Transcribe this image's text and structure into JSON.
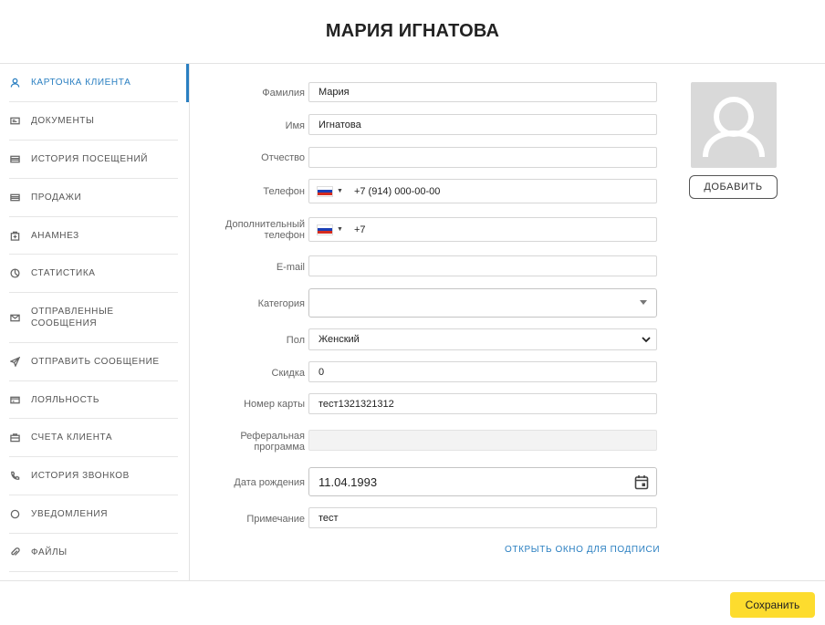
{
  "header": {
    "title": "МАРИЯ ИГНАТОВА"
  },
  "sidebar": {
    "items": [
      {
        "label": "КАРТОЧКА КЛИЕНТА",
        "icon": "user-icon",
        "active": true
      },
      {
        "label": "ДОКУМЕНТЫ",
        "icon": "id-card-icon"
      },
      {
        "label": "ИСТОРИЯ ПОСЕЩЕНИЙ",
        "icon": "list-icon"
      },
      {
        "label": "ПРОДАЖИ",
        "icon": "list-icon"
      },
      {
        "label": "АНАМНЕЗ",
        "icon": "medical-icon"
      },
      {
        "label": "СТАТИСТИКА",
        "icon": "pie-chart-icon"
      },
      {
        "label": "ОТПРАВЛЕННЫЕ СООБЩЕНИЯ",
        "icon": "envelope-icon"
      },
      {
        "label": "ОТПРАВИТЬ СООБЩЕНИЕ",
        "icon": "send-icon"
      },
      {
        "label": "ЛОЯЛЬНОСТЬ",
        "icon": "card-icon"
      },
      {
        "label": "СЧЕТА КЛИЕНТА",
        "icon": "briefcase-icon"
      },
      {
        "label": "ИСТОРИЯ ЗВОНКОВ",
        "icon": "phone-icon"
      },
      {
        "label": "УВЕДОМЛЕНИЯ",
        "icon": "circle-icon"
      },
      {
        "label": "ФАЙЛЫ",
        "icon": "paperclip-icon"
      }
    ]
  },
  "form": {
    "last_name": {
      "label": "Фамилия",
      "value": "Мария"
    },
    "first_name": {
      "label": "Имя",
      "value": "Игнатова"
    },
    "middle_name": {
      "label": "Отчество",
      "value": ""
    },
    "phone": {
      "label": "Телефон",
      "value": "+7 (914) 000-00-00"
    },
    "extra_phone": {
      "label": "Дополнительный телефон",
      "value": "+7"
    },
    "email": {
      "label": "E-mail",
      "value": ""
    },
    "category": {
      "label": "Категория",
      "value": ""
    },
    "gender": {
      "label": "Пол",
      "value": "Женский"
    },
    "discount": {
      "label": "Скидка",
      "value": "0"
    },
    "card_number": {
      "label": "Номер карты",
      "value": "тест1321321312"
    },
    "referral": {
      "label": "Реферальная программа",
      "value": ""
    },
    "birth_date": {
      "label": "Дата рождения",
      "value": "11.04.1993"
    },
    "note": {
      "label": "Примечание",
      "value": "тест"
    }
  },
  "photo": {
    "add_label": "ДОБАВИТЬ"
  },
  "signature_link": "ОТКРЫТЬ ОКНО ДЛЯ ПОДПИСИ",
  "footer": {
    "save_label": "Сохранить"
  },
  "colors": {
    "accent": "#2a7fc1",
    "save": "#fddc2e"
  }
}
